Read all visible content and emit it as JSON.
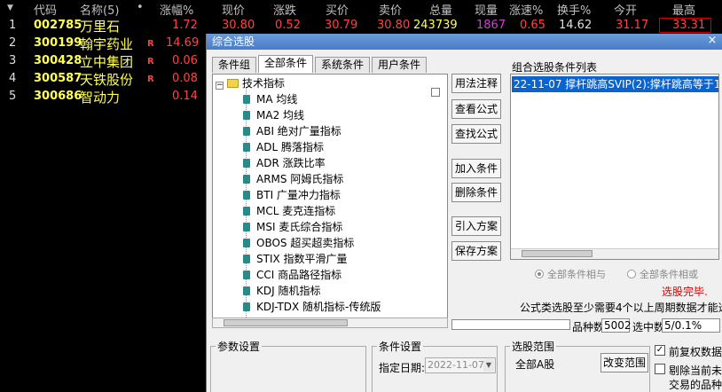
{
  "header": {
    "code": "代码",
    "name": "名称(5)",
    "dot": "•",
    "chg_pct": "涨幅%",
    "price": "现价",
    "chg": "涨跌",
    "bid": "买价",
    "ask": "卖价",
    "volume": "总量",
    "cur_vol": "现量",
    "speed": "涨速%",
    "turnover": "换手%",
    "open": "今开",
    "high": "最高",
    "arrow": "▼"
  },
  "rows": [
    {
      "idx": "1",
      "code": "002785",
      "name": "万里石",
      "r": "",
      "chg_pct": "1.72",
      "price": "30.80",
      "chg": "0.52",
      "bid": "30.79",
      "ask": "30.80",
      "volume": "243739",
      "cur_vol": "1867",
      "speed": "0.65",
      "turnover": "14.62",
      "open": "31.17",
      "high": "33.31"
    },
    {
      "idx": "2",
      "code": "300199",
      "name": "翰宇药业",
      "r": "R",
      "chg_pct": "14.69"
    },
    {
      "idx": "3",
      "code": "300428",
      "name": "立中集团",
      "r": "R",
      "chg_pct": "0.06"
    },
    {
      "idx": "4",
      "code": "300587",
      "name": "天铁股份",
      "r": "R",
      "chg_pct": "0.08"
    },
    {
      "idx": "5",
      "code": "300686",
      "name": "智动力",
      "r": "",
      "chg_pct": "0.14"
    }
  ],
  "dialog": {
    "title": "综合选股",
    "close": "×",
    "tabs": [
      "条件组",
      "全部条件",
      "系统条件",
      "用户条件"
    ],
    "tree": {
      "root": "技术指标",
      "items": [
        "MA 均线",
        "MA2 均线",
        "ABI 绝对广量指标",
        "ADL 腾落指标",
        "ADR 涨跌比率",
        "ARMS 阿姆氏指标",
        "BTI 广量冲力指标",
        "MCL 麦克连指标",
        "MSI 麦氏综合指标",
        "OBOS 超买超卖指标",
        "STIX 指数平滑广量",
        "CCI 商品路径指标",
        "KDJ 随机指标",
        "KDJ-TDX 随机指标-传统版"
      ]
    },
    "buttons": {
      "usage": "用法注释",
      "view_formula": "查看公式",
      "find_formula": "查找公式",
      "add_cond": "加入条件",
      "del_cond": "删除条件",
      "import_plan": "引入方案",
      "save_plan": "保存方案",
      "change_range": "改变范围"
    },
    "combo": {
      "label": "组合选股条件列表",
      "items": [
        "22-11-07 撑杆跳高SVIP(2):撑杆跳高等于1"
      ]
    },
    "radio_and": "全部条件相与",
    "radio_or": "全部条件相或",
    "status": "选股完毕.",
    "note": "公式类选股至少需要4个以上周期数据才能选出",
    "stats": {
      "count_label": "品种数",
      "count_value": "5002",
      "selected_label": "选中数",
      "selected_value": "5/0.1%"
    },
    "params_title": "参数设置",
    "cond_title": "条件设置",
    "date_label": "指定日期:",
    "date_value": "2022-11-07",
    "range_title": "选股范围",
    "range_value": "全部A股",
    "check_adjust": "前复权数据",
    "check_exclude_1": "剔除当前未",
    "check_exclude_2": "交易的品种"
  }
}
